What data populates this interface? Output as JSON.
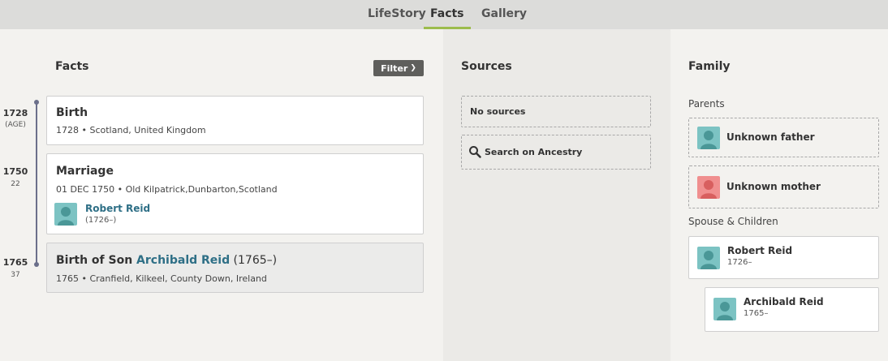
{
  "tabs": [
    {
      "label": "LifeStory"
    },
    {
      "label": "Facts"
    },
    {
      "label": "Gallery"
    }
  ],
  "facts": {
    "heading": "Facts",
    "filter_label": "Filter",
    "items": [
      {
        "year": "1728",
        "age": "(AGE)",
        "title": "Birth",
        "detail": "1728 • Scotland, United Kingdom"
      },
      {
        "year": "1750",
        "age": "22",
        "title": "Marriage",
        "detail": "01 DEC 1750 • Old Kilpatrick,Dunbarton,Scotland",
        "person_name": "Robert Reid",
        "person_dates": "(1726–)"
      },
      {
        "year": "1765",
        "age": "37",
        "title_prefix": "Birth of Son ",
        "title_link": "Archibald Reid",
        "title_suffix": " (1765–)",
        "detail": "1765 • Cranfield, Kilkeel, County Down, Ireland"
      }
    ]
  },
  "sources": {
    "heading": "Sources",
    "no_sources": "No sources",
    "search_label": "Search on Ancestry"
  },
  "family": {
    "heading": "Family",
    "parents_label": "Parents",
    "father": "Unknown father",
    "mother": "Unknown mother",
    "spouse_children_label": "Spouse & Children",
    "spouse_name": "Robert Reid",
    "spouse_dates": "1726–",
    "child_name": "Archibald Reid",
    "child_dates": "1765–"
  },
  "colors": {
    "accent_tab": "#9cbc4c",
    "link": "#2e6f86",
    "male_avatar": "#7cc3c3",
    "female_avatar": "#f08f8f"
  }
}
